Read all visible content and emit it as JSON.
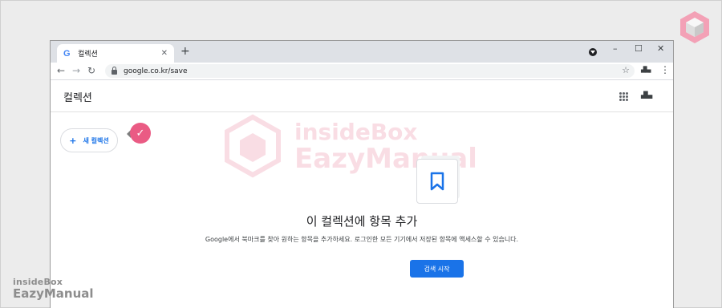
{
  "browser": {
    "tab_title": "컬렉션",
    "tab_favicon": "G",
    "url": "google.co.kr/save",
    "window_controls": [
      "–",
      "☐",
      "✕"
    ]
  },
  "app": {
    "title": "컬렉션",
    "new_collection_label": "새 컬렉션"
  },
  "empty_state": {
    "title": "이 컬렉션에 항목 추가",
    "description": "Google에서 북마크를 찾아 원하는 항목을 추가하세요. 로그인한 모든 기기에서 저장된 항목에 액세스할 수 있습니다.",
    "button_label": "검색 시작"
  },
  "watermark": {
    "line1": "insideBox",
    "line2": "EazyManual"
  },
  "colors": {
    "accent": "#1a73e8",
    "badge": "#ea5b84",
    "watermark": "#e0486c"
  }
}
